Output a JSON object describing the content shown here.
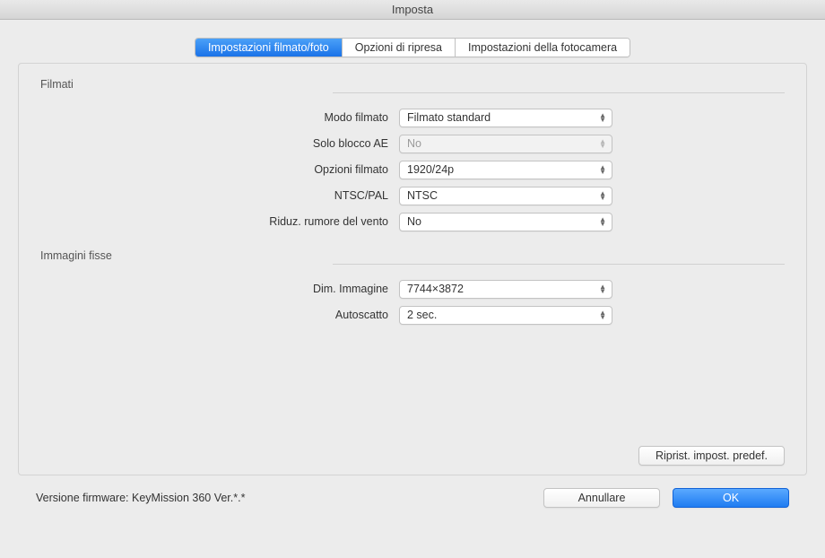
{
  "window_title": "Imposta",
  "tabs": {
    "movie_photo": "Impostazioni filmato/foto",
    "shooting_options": "Opzioni di ripresa",
    "camera_settings": "Impostazioni della fotocamera"
  },
  "sections": {
    "movies_title": "Filmati",
    "stills_title": "Immagini fisse"
  },
  "fields": {
    "movie_mode": {
      "label": "Modo filmato",
      "value": "Filmato standard"
    },
    "ae_lock_only": {
      "label": "Solo blocco AE",
      "value": "No"
    },
    "movie_options": {
      "label": "Opzioni filmato",
      "value": "1920/24p"
    },
    "ntsc_pal": {
      "label": "NTSC/PAL",
      "value": "NTSC"
    },
    "wind_noise": {
      "label": "Riduz. rumore del vento",
      "value": "No"
    },
    "image_size": {
      "label": "Dim. Immagine",
      "value": "7744×3872"
    },
    "self_timer": {
      "label": "Autoscatto",
      "value": "2 sec."
    }
  },
  "buttons": {
    "reset": "Riprist. impost. predef.",
    "cancel": "Annullare",
    "ok": "OK"
  },
  "footer": {
    "firmware_label": "Versione firmware:",
    "firmware_value": "KeyMission 360 Ver.*.*"
  }
}
